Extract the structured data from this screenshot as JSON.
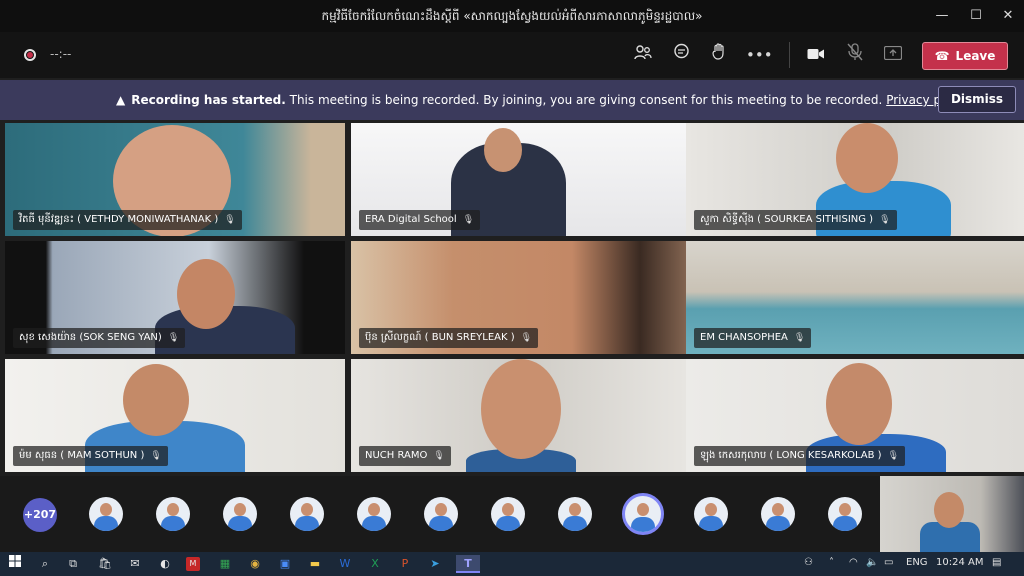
{
  "window": {
    "title": "កម្មវិធីចែករំលែកចំណេះដឹងស្តីពី «សាកល្បងស្វែងយល់អំពីសារភាសាលាភូមិន្ទរដ្ឋបាល»",
    "controls": {
      "minimize": "—",
      "maximize": "☐",
      "close": "✕"
    }
  },
  "toolbar": {
    "timer": "--:--",
    "icons": [
      "people-icon",
      "chat-icon",
      "raise-hand-icon",
      "more-icon",
      "camera-icon",
      "mic-off-icon",
      "share-icon"
    ],
    "leave_label": "Leave"
  },
  "banner": {
    "title": "Recording has started.",
    "message": "This meeting is being recorded. By joining, you are giving consent for this meeting to be recorded.",
    "link": "Privacy policy",
    "dismiss_label": "Dismiss"
  },
  "participants": [
    {
      "name": "វិតធី មុនីវឌ្ឍនះ ( VETHDY MONIWATHANAK )",
      "bg": "#2e6f7e"
    },
    {
      "name": "ERA Digital School",
      "bg": "#f0f0f2"
    },
    {
      "name": "សួកា សិទ្ធីស៊ីង ( SOURKEA SITHISING )",
      "bg": "#d9d9d6"
    },
    {
      "name": "សុខ សេងយ៉ាន (SOK SENG YAN)",
      "bg": "#a8b4c4"
    },
    {
      "name": "ប៊ុន ស្រីលក្ខណ៍ ( BUN SREYLEAK )",
      "bg": "#c9a27c"
    },
    {
      "name": "EM CHANSOPHEA",
      "bg": "#7aa9b6"
    },
    {
      "name": "ម៉ម សុធន ( MAM SOTHUN )",
      "bg": "#e8e6e2"
    },
    {
      "name": "NUCH RAMO",
      "bg": "#dcdad6"
    },
    {
      "name": "ឡុង កេសរកុលាប ( LONG KESARKOLAB )",
      "bg": "#e4e3e0"
    }
  ],
  "strip": {
    "overflow_count": "+207"
  },
  "taskbar": {
    "lang": "ENG",
    "time": "10:24 AM"
  }
}
